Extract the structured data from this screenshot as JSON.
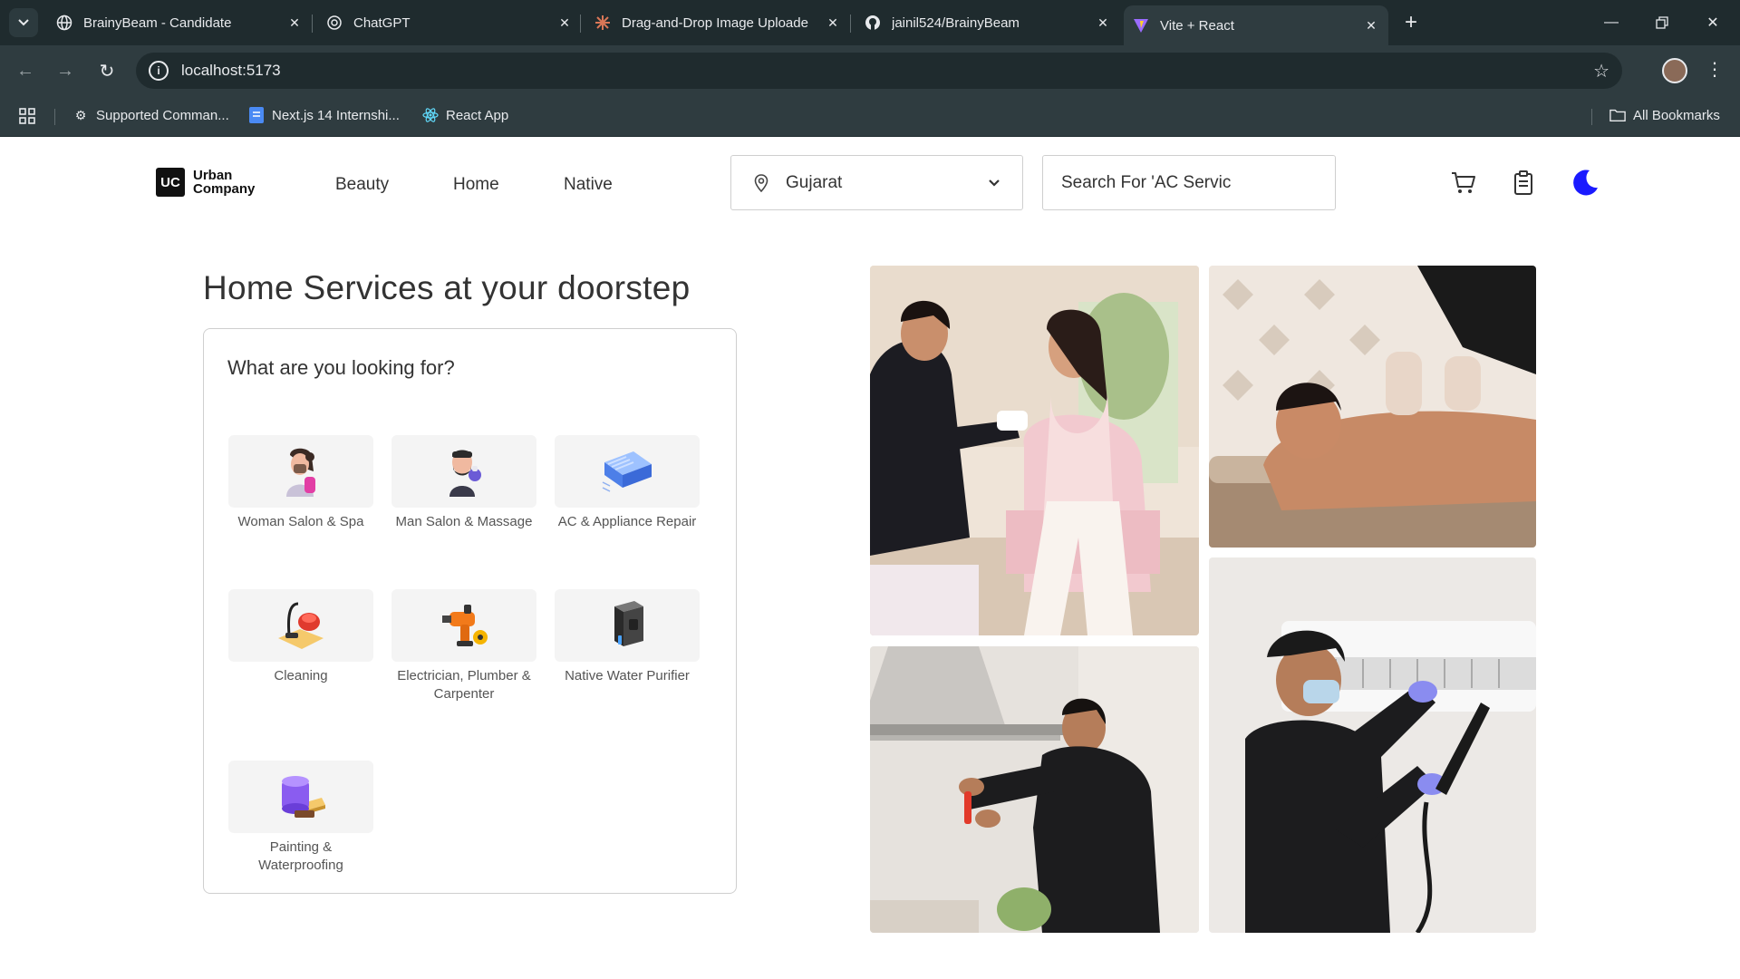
{
  "browser": {
    "tabs": [
      {
        "title": "BrainyBeam - Candidate",
        "icon": "globe-icon"
      },
      {
        "title": "ChatGPT",
        "icon": "chatgpt-icon"
      },
      {
        "title": "Drag-and-Drop Image Uploade",
        "icon": "claude-icon"
      },
      {
        "title": "jainil524/BrainyBeam",
        "icon": "github-icon"
      },
      {
        "title": "Vite + React",
        "icon": "vite-icon",
        "active": true
      }
    ],
    "url": "localhost:5173",
    "bookmarks": [
      {
        "label": "Supported Comman...",
        "icon": "gear-icon"
      },
      {
        "label": "Next.js 14 Internshi...",
        "icon": "doc-icon"
      },
      {
        "label": "React App",
        "icon": "react-icon"
      }
    ],
    "all_bookmarks": "All Bookmarks"
  },
  "header": {
    "logo_mark": "UC",
    "logo_line1": "Urban",
    "logo_line2": "Company",
    "nav": [
      "Beauty",
      "Home",
      "Native"
    ],
    "location": "Gujarat",
    "search_placeholder": "Search For  'AC Servic",
    "accent_color": "#1a1aff"
  },
  "hero": {
    "title": "Home Services at your doorstep",
    "card_title": "What are you looking for?",
    "services": [
      {
        "label": "Woman Salon & Spa",
        "icon": "woman-salon-icon"
      },
      {
        "label": "Man Salon & Massage",
        "icon": "man-salon-icon"
      },
      {
        "label": "AC & Appliance Repair",
        "icon": "ac-repair-icon"
      },
      {
        "label": "Cleaning",
        "icon": "vacuum-icon"
      },
      {
        "label": "Electrician, Plumber & Carpenter",
        "icon": "drill-icon"
      },
      {
        "label": "Native Water Purifier",
        "icon": "water-purifier-icon"
      },
      {
        "label": "Painting & Waterproofing",
        "icon": "paint-icon"
      }
    ]
  }
}
